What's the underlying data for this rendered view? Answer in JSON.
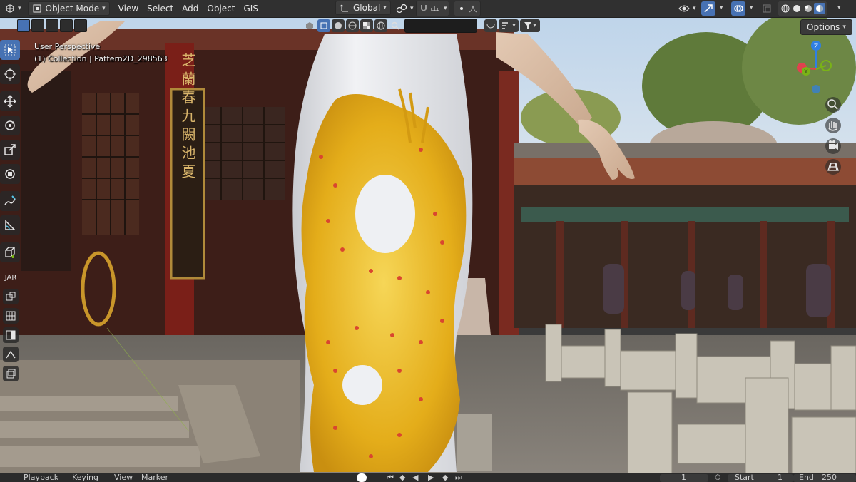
{
  "header": {
    "mode_label": "Object Mode",
    "menus": [
      "View",
      "Select",
      "Add",
      "Object",
      "GIS"
    ],
    "transform_orientation": "Global"
  },
  "options_label": "Options",
  "viewport": {
    "perspective_label": "User Perspective",
    "collection_label": "(1) Collection | Pattern2D_298563",
    "signboard_text": "芝蘭春 九闕池夏"
  },
  "addon_tab_label": "JAR",
  "gizmo": {
    "axes": [
      "Z",
      "Y",
      "X"
    ],
    "colors": {
      "x": "#e0424e",
      "y": "#7ab317",
      "z": "#2f7fe5"
    }
  },
  "timeline": {
    "playback_label": "Playback",
    "keying_label": "Keying",
    "view_label": "View",
    "marker_label": "Marker",
    "current_frame": "1",
    "start_label": "Start",
    "start_value": "1",
    "end_label": "End",
    "end_value": "250"
  },
  "colors": {
    "accent": "#4772b3",
    "header_bg": "#303030",
    "dress": "#e6e8ec",
    "dragon": "#e8b61f"
  }
}
